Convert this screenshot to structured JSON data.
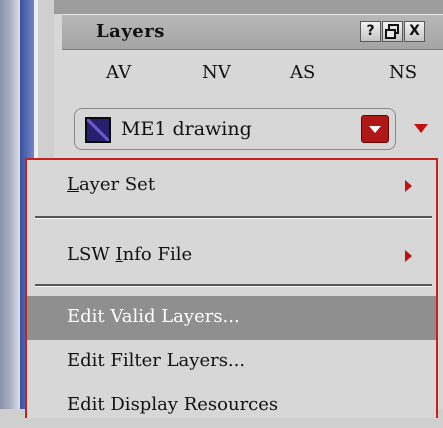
{
  "window": {
    "title": "Layers",
    "buttons": {
      "help": "?",
      "float": "🗗",
      "close": "X"
    }
  },
  "tabs": [
    "AV",
    "NV",
    "AS",
    "NS"
  ],
  "layer_select": {
    "selected": "ME1 drawing",
    "swatch_color": "#2a1f6e",
    "accent_color": "#b01818"
  },
  "menu": {
    "items": [
      {
        "label_pre": "",
        "label_ul": "L",
        "label_post": "ayer Set",
        "has_submenu": true
      },
      {
        "label_pre": "LSW ",
        "label_ul": "I",
        "label_post": "nfo File",
        "has_submenu": true
      },
      {
        "label": "Edit Valid Layers...",
        "highlighted": true
      },
      {
        "label": "Edit Filter Layers..."
      },
      {
        "label": "Edit Display Resources"
      }
    ]
  }
}
